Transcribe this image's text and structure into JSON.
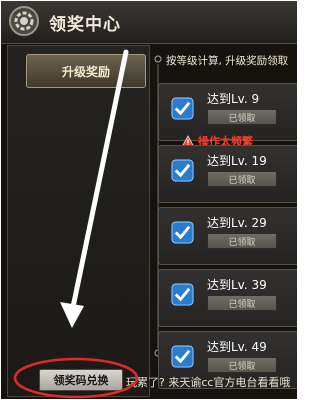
{
  "window": {
    "title": "领奖中心"
  },
  "left": {
    "upgrade_reward_label": "升级奖励",
    "redeem_label": "领奖码兑换",
    "promo_text": "玩累了? 来天谕cc官方电台看看哦"
  },
  "right": {
    "description": "按等级计算, 升级奖励领取",
    "warning": "操作太频繁",
    "rewards": [
      {
        "level": "达到Lv. 9",
        "status": "已领取"
      },
      {
        "level": "达到Lv. 19",
        "status": "已领取"
      },
      {
        "level": "达到Lv. 29",
        "status": "已领取"
      },
      {
        "level": "达到Lv. 39",
        "status": "已领取"
      },
      {
        "level": "达到Lv. 49",
        "status": "已领取"
      }
    ]
  },
  "colors": {
    "annotation_arrow": "#ffffff",
    "annotation_circle": "#e0292a",
    "warning_text": "#ff3b2c",
    "check_blue": "#2a7ccc"
  },
  "icons": {
    "title": "gear-icon",
    "reward_check": "checkmark-icon",
    "warning": "warning-triangle-icon"
  }
}
